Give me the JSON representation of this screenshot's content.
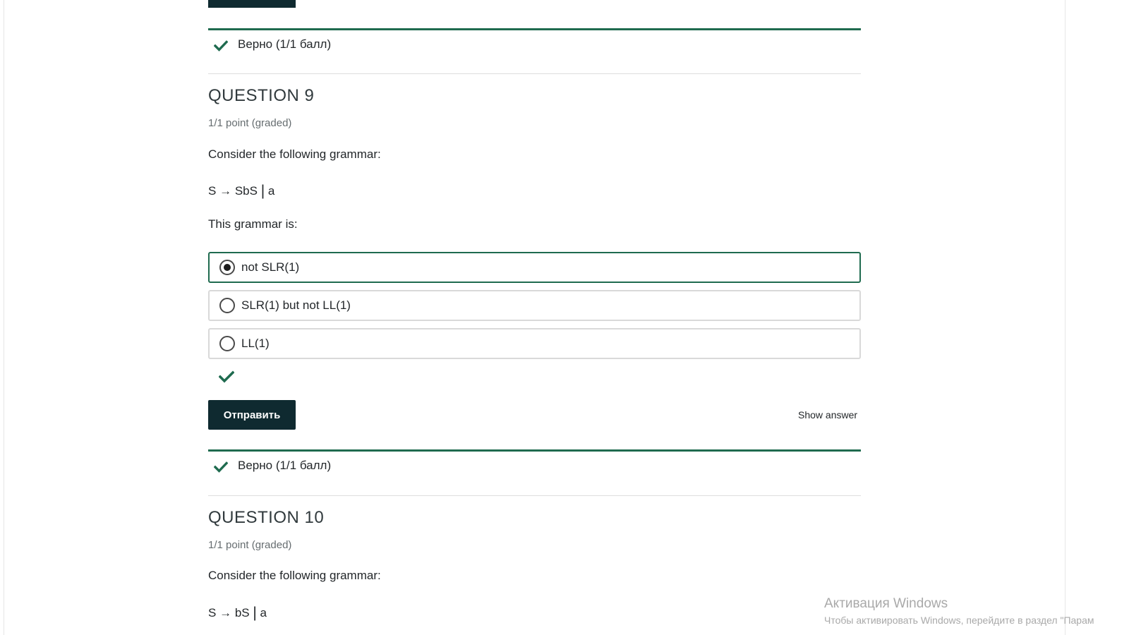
{
  "prev_question": {
    "status_text": "Верно (1/1 балл)"
  },
  "question9": {
    "title": "QUESTION 9",
    "points": "1/1 point (graded)",
    "prompt": "Consider the following grammar:",
    "grammar": {
      "lhs": "S",
      "arrow": "→",
      "rhs1": "SbS",
      "bar": "|",
      "rhs2": "a"
    },
    "sub_prompt": "This grammar is:",
    "options": [
      {
        "label": "not SLR(1)",
        "selected": true
      },
      {
        "label": "SLR(1) but not LL(1)",
        "selected": false
      },
      {
        "label": "LL(1)",
        "selected": false
      }
    ],
    "submit_label": "Отправить",
    "show_answer_label": "Show answer",
    "status_text": "Верно (1/1 балл)"
  },
  "question10": {
    "title": "QUESTION 10",
    "points": "1/1 point (graded)",
    "prompt": "Consider the following grammar:",
    "grammar": {
      "lhs": "S",
      "arrow": "→",
      "rhs1": "bS",
      "bar": "|",
      "rhs2": "a"
    }
  },
  "watermark": {
    "title": "Активация Windows",
    "subtitle": "Чтобы активировать Windows, перейдите в раздел \"Парам"
  },
  "colors": {
    "accent_green": "#1f6b4f",
    "button_dark": "#0f2a30"
  },
  "icons": {
    "status_check": "check-icon",
    "answer_check": "check-icon"
  }
}
